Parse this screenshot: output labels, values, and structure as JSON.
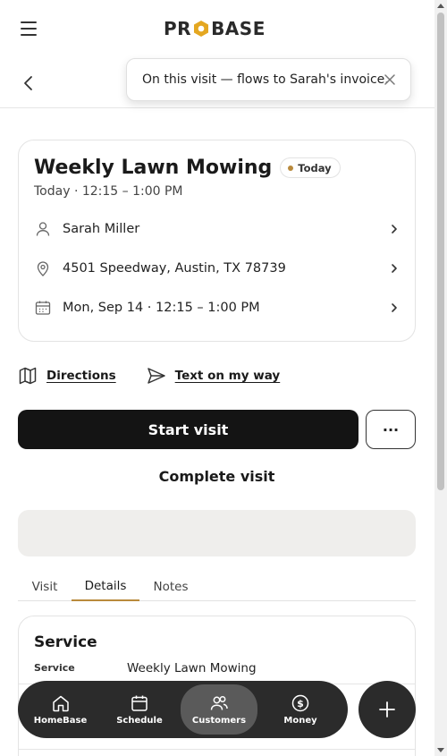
{
  "header": {
    "logo_left": "PR",
    "logo_right": "BASE",
    "menu_icon": "hamburger-menu-icon",
    "back_icon": "chevron-left-icon"
  },
  "toast": {
    "message": "On this visit — flows to Sarah's invoice.",
    "close_icon": "close-icon"
  },
  "visit": {
    "title": "Weekly Lawn Mowing",
    "badge": "Today",
    "time": "Today · 12:15 – 1:00 PM",
    "rows": [
      {
        "icon": "person-icon",
        "text": "Sarah Miller"
      },
      {
        "icon": "location-pin-icon",
        "text": "4501 Speedway, Austin, TX 78739"
      },
      {
        "icon": "calendar-icon",
        "text": "Mon, Sep 14 · 12:15 – 1:00 PM"
      }
    ]
  },
  "actions": {
    "directions": "Directions",
    "text_on_my_way": "Text on my way",
    "start_visit": "Start visit",
    "more": "···",
    "complete_visit": "Complete visit"
  },
  "tabs": [
    {
      "label": "Visit",
      "active": false
    },
    {
      "label": "Details",
      "active": true
    },
    {
      "label": "Notes",
      "active": false
    }
  ],
  "details": {
    "heading": "Service",
    "fields": [
      {
        "key": "Service",
        "value": "Weekly Lawn Mowing"
      }
    ]
  },
  "bottom_nav": [
    {
      "label": "HomeBase",
      "icon": "home-icon",
      "active": false
    },
    {
      "label": "Schedule",
      "icon": "calendar-icon",
      "active": false
    },
    {
      "label": "Customers",
      "icon": "users-icon",
      "active": true
    },
    {
      "label": "Money",
      "icon": "dollar-icon",
      "active": false
    }
  ],
  "colors": {
    "accent": "#b98a3c",
    "dark": "#141414",
    "nav_bg": "#2b2b2b",
    "nav_active": "#5a5a5a"
  }
}
